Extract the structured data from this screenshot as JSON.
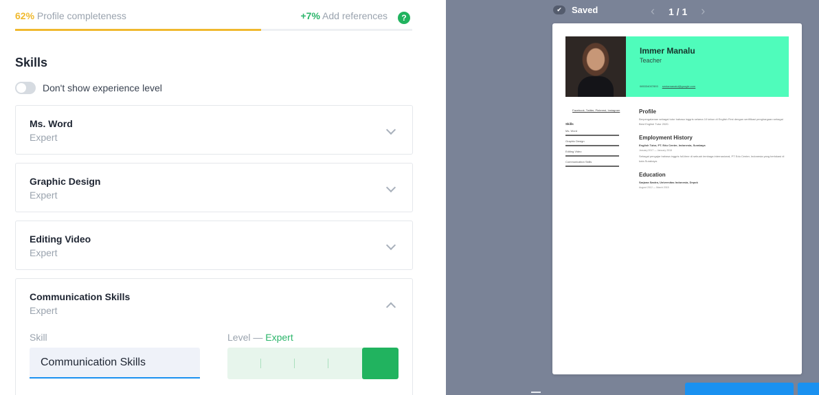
{
  "progress": {
    "percent_text": "62%",
    "label": "Profile completeness",
    "fraction": 0.62,
    "hint_plus": "+7%",
    "hint_label": "Add references",
    "help_glyph": "?",
    "accent": "#f0b92e"
  },
  "skills_section": {
    "title": "Skills",
    "toggle_label": "Don't show experience level",
    "items": [
      {
        "name": "Ms. Word",
        "level": "Expert"
      },
      {
        "name": "Graphic Design",
        "level": "Expert"
      },
      {
        "name": "Editing Video",
        "level": "Expert"
      },
      {
        "name": "Communication Skills",
        "level": "Expert"
      }
    ],
    "editor": {
      "skill_label": "Skill",
      "skill_value": "Communication Skills",
      "level_label": "Level — ",
      "level_value": "Expert",
      "level_selected": 5,
      "level_steps": 5
    }
  },
  "preview": {
    "saved_label": "Saved",
    "page_indicator": "1 / 1",
    "prev_glyph": "‹",
    "next_glyph": "›",
    "resume": {
      "name": "Immer Manalu",
      "job_title": "Teacher",
      "phone": "085334007893",
      "email": "sentamanalul@google.com",
      "links": "Facebook, Twitter, Pinterest, Instagram",
      "skills_heading": "Skills",
      "skills": [
        "Ms. Word",
        "Graphic Design",
        "Editing Video",
        "Communication Skills"
      ],
      "profile_heading": "Profile",
      "profile_text": "Berpengalaman sebagai tutor bahasa inggris selama 10 tahun di English First dengan sertifikasi penghargaan sebagai Best English Tutor 2020.",
      "employment_heading": "Employment History",
      "employment_role": "English Tutor, PT. Edu Center, Indonesia, Surabaya",
      "employment_dates": "January 2017 — January 2018",
      "employment_desc": "Sebagai pengajar bahasa inggris full-time di sebuah lembaga internasional, PT Edu Center, Indonesia yang berlokasi di kota Surabaya.",
      "education_heading": "Education",
      "education_degree": "Sarjana Sastra, Universitas Indonesia, Depok",
      "education_dates": "August 2012 — March 2015",
      "header_color": "#4ffcbb"
    }
  },
  "colors": {
    "green": "#21b35f",
    "blue": "#1a91f0",
    "preview_bg": "#7a8397"
  }
}
